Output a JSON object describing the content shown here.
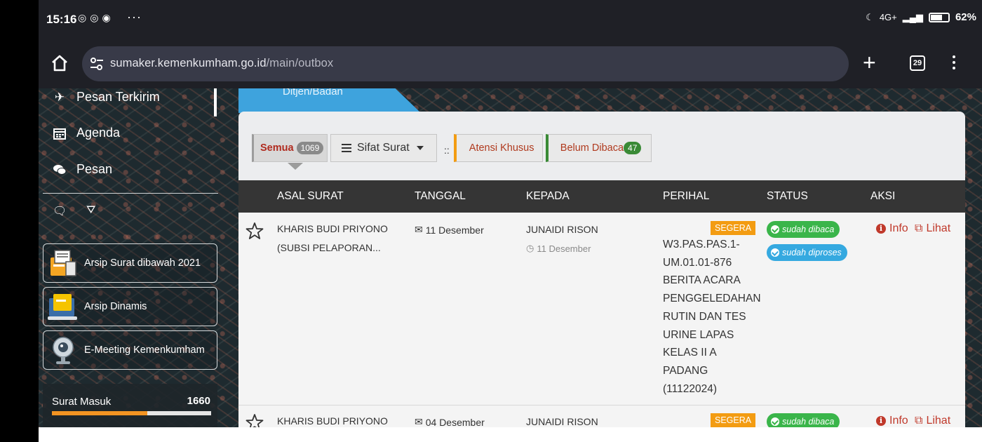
{
  "status_bar": {
    "time": "15:16",
    "notif_dots": "···",
    "battery": "62%",
    "network": "4G+"
  },
  "browser": {
    "url_domain": "sumaker.kemenkumham.go.id",
    "url_path": "/main/outbox",
    "tab_count": "29"
  },
  "sidebar": {
    "items": [
      {
        "label": "Pesan Terkirim",
        "icon": "send-icon"
      },
      {
        "label": "Agenda",
        "icon": "calendar-icon"
      },
      {
        "label": "Pesan",
        "icon": "chat-icon"
      }
    ],
    "cards": [
      {
        "label": "Arsip Surat dibawah 2021",
        "icon": "archive-folder-icon"
      },
      {
        "label": "Arsip Dinamis",
        "icon": "laptop-folder-icon"
      },
      {
        "label": "E-Meeting Kemenkumham",
        "icon": "webcam-icon"
      }
    ],
    "surat_masuk": {
      "label": "Surat Masuk",
      "count": "1660",
      "progress_fraction": 0.6
    }
  },
  "main": {
    "tab_label": "Ditjen/Badan",
    "filters": {
      "semua": "Semua",
      "semua_count": "1069",
      "sifat": "Sifat Surat",
      "separator": "::",
      "atensi": "Atensi Khusus",
      "belum": "Belum Dibaca",
      "belum_count": "47"
    },
    "columns": [
      "ASAL SURAT",
      "TANGGAL",
      "KEPADA",
      "PERIHAL",
      "STATUS",
      "AKSI"
    ],
    "rows": [
      {
        "asal_line1": "KHARIS BUDI PRIYONO",
        "asal_line2": "(SUBSI PELAPORAN...",
        "tanggal": "11 Desember",
        "kepada": "JUNAIDI RISON",
        "kepada_sub": "11 Desember",
        "badge": "SEGERA",
        "perihal": "W3.PAS.PAS.1-UM.01.01-876 BERITA ACARA PENGGELEDAHAN RUTIN DAN TES URINE LAPAS KELAS II A PADANG (11122024)",
        "status1": "sudah dibaca",
        "status2": "sudah diproses",
        "aksi_info": "Info",
        "aksi_lihat": "Lihat"
      },
      {
        "asal_line1": "KHARIS BUDI PRIYONO",
        "tanggal": "04 Desember",
        "kepada": "JUNAIDI RISON",
        "badge": "SEGERA",
        "status1": "sudah dibaca",
        "aksi_info": "Info",
        "aksi_lihat": "Lihat"
      }
    ]
  },
  "colors": {
    "accent_blue": "#3ea3dd",
    "segera_orange": "#f39c12",
    "status_green": "#3ab54a",
    "status_blue": "#35a9e0",
    "action_red": "#c0392b",
    "header_dark": "#353535"
  }
}
